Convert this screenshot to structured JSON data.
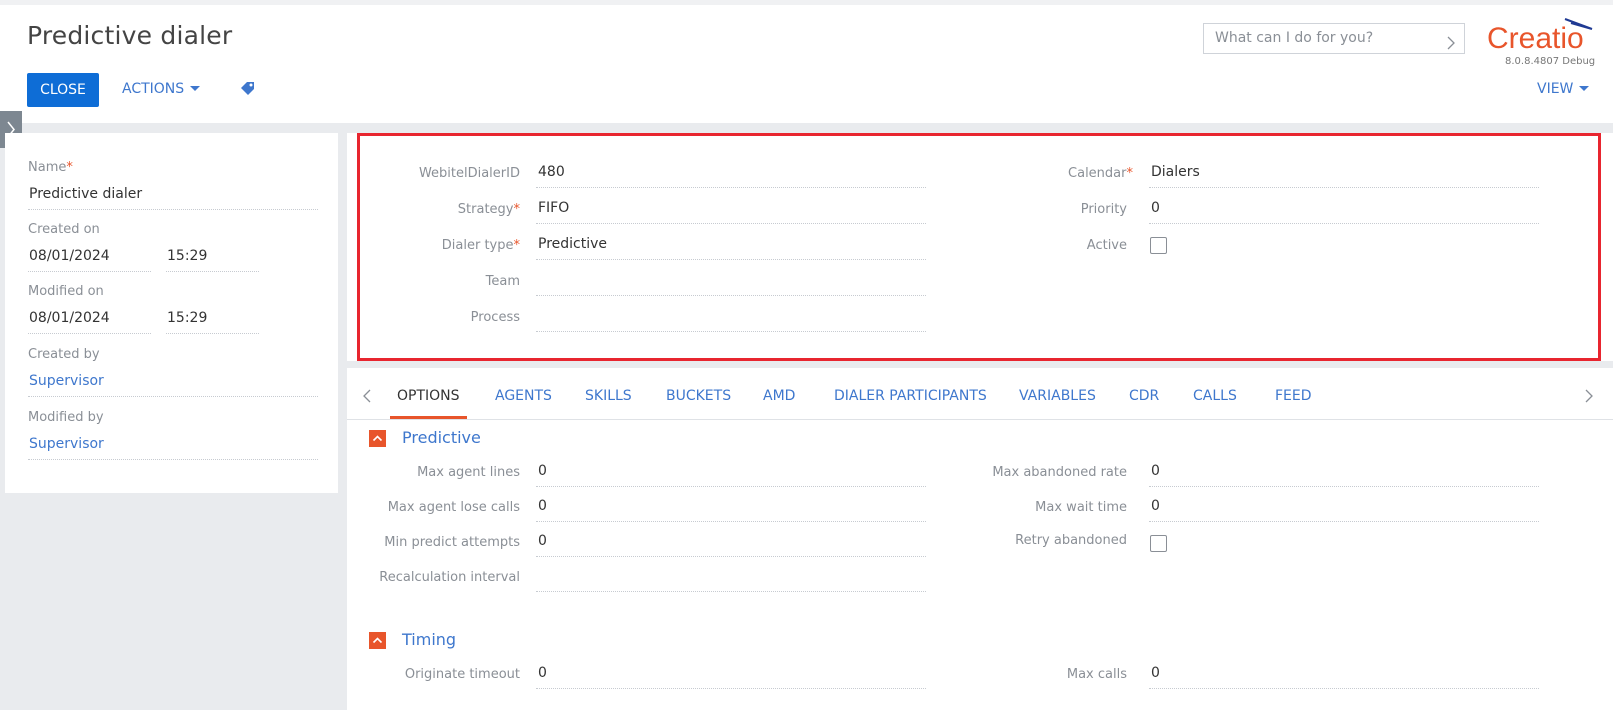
{
  "header": {
    "title": "Predictive dialer",
    "close_label": "CLOSE",
    "actions_label": "ACTIONS",
    "view_label": "VIEW",
    "search_placeholder": "What can I do for you?",
    "logo_text": "Creatio",
    "version": "8.0.8.4807 Debug"
  },
  "left": {
    "name_label": "Name",
    "name_value": "Predictive dialer",
    "created_on_label": "Created on",
    "created_on_date": "08/01/2024",
    "created_on_time": "15:29",
    "modified_on_label": "Modified on",
    "modified_on_date": "08/01/2024",
    "modified_on_time": "15:29",
    "created_by_label": "Created by",
    "created_by_value": "Supervisor",
    "modified_by_label": "Modified by",
    "modified_by_value": "Supervisor"
  },
  "main": {
    "webitel_label": "WebitelDialerID",
    "webitel_value": "480",
    "strategy_label": "Strategy",
    "strategy_value": "FIFO",
    "dialer_type_label": "Dialer type",
    "dialer_type_value": "Predictive",
    "team_label": "Team",
    "team_value": "",
    "process_label": "Process",
    "process_value": "",
    "calendar_label": "Calendar",
    "calendar_value": "Dialers",
    "priority_label": "Priority",
    "priority_value": "0",
    "active_label": "Active",
    "active_checked": false
  },
  "tabs": [
    {
      "label": "OPTIONS"
    },
    {
      "label": "AGENTS"
    },
    {
      "label": "SKILLS"
    },
    {
      "label": "BUCKETS"
    },
    {
      "label": "AMD"
    },
    {
      "label": "DIALER PARTICIPANTS"
    },
    {
      "label": "VARIABLES"
    },
    {
      "label": "CDR"
    },
    {
      "label": "CALLS"
    },
    {
      "label": "FEED"
    }
  ],
  "predictive": {
    "title": "Predictive",
    "max_agent_lines_label": "Max agent lines",
    "max_agent_lines_value": "0",
    "max_agent_lose_calls_label": "Max agent lose calls",
    "max_agent_lose_calls_value": "0",
    "min_predict_attempts_label": "Min predict attempts",
    "min_predict_attempts_value": "0",
    "recalc_interval_label": "Recalculation interval",
    "recalc_interval_value": "",
    "max_abandoned_rate_label": "Max abandoned rate",
    "max_abandoned_rate_value": "0",
    "max_wait_time_label": "Max wait time",
    "max_wait_time_value": "0",
    "retry_abandoned_label": "Retry abandoned",
    "retry_abandoned_checked": false
  },
  "timing": {
    "title": "Timing",
    "originate_timeout_label": "Originate timeout",
    "originate_timeout_value": "0",
    "max_calls_label": "Max calls",
    "max_calls_value": "0"
  },
  "colors": {
    "accent": "#0e6dd6",
    "link": "#3e77cd",
    "brand": "#e8552b",
    "highlight": "#e8252f"
  }
}
